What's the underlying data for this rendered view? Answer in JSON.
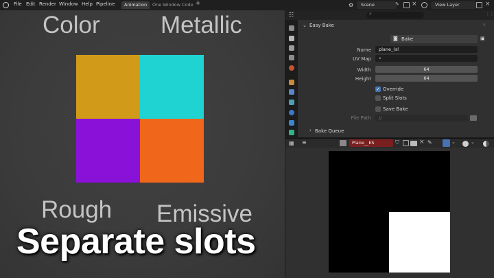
{
  "menu": {
    "items": [
      "File",
      "Edit",
      "Render",
      "Window",
      "Help",
      "Pipeline"
    ]
  },
  "workspace_tabs": [
    "Animation",
    "One Window Code"
  ],
  "add_tab": "+",
  "scene": {
    "value": "Scene"
  },
  "view_layer": {
    "value": "View Layer"
  },
  "viewport": {
    "labels": {
      "color": "Color",
      "metallic": "Metallic",
      "rough": "Rough",
      "emissive": "Emissive"
    },
    "swatches": {
      "color": "#d29a19",
      "metallic": "#1fd3d3",
      "rough": "#8a12d8",
      "emissive": "#f0661a"
    },
    "caption": "Separate slots"
  },
  "properties": {
    "search_placeholder": "",
    "panel_title": "Easy Bake",
    "bake_button": "Bake",
    "fields": {
      "name_label": "Name",
      "name_value": "plane_(sl",
      "uvmap_label": "UV Map",
      "uvmap_value": "•",
      "width_label": "Width",
      "width_value": "64",
      "height_label": "Height",
      "height_value": "64"
    },
    "override": {
      "label": "Override",
      "checked": true
    },
    "split_slots": {
      "label": "Split Slots",
      "checked": false
    },
    "save_bake": {
      "label": "Save Bake",
      "checked": false
    },
    "file_path": {
      "label": "File Path",
      "value": "//"
    },
    "bake_queue": "Bake Queue"
  },
  "image_editor": {
    "image_name": "Plane__ES",
    "colors": {
      "black": "#000000",
      "white": "#ffffff"
    }
  },
  "colors": {
    "accent": "#4772b3",
    "panel": "#303030",
    "background": "#1d1d1d"
  }
}
